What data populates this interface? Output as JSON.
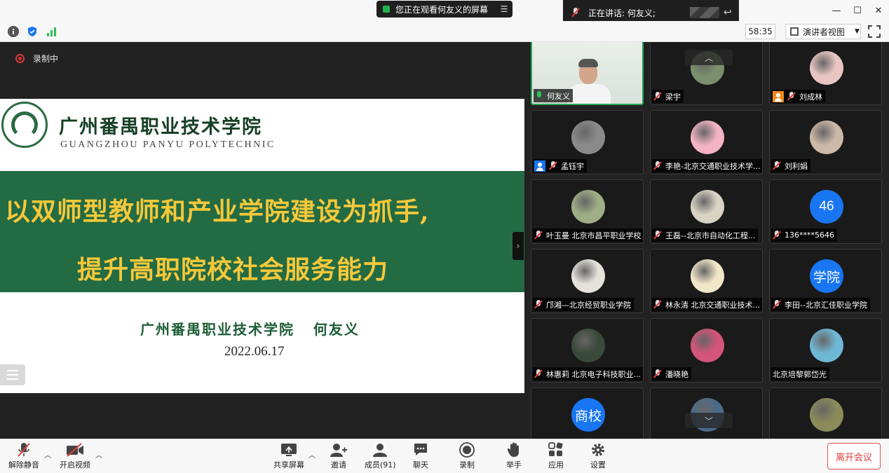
{
  "titlebar": {
    "viewing_text": "您正在观看何友义的屏幕",
    "speaking_text": "正在讲话: 何友义;",
    "window_controls": [
      "minimize-icon",
      "maximize-icon",
      "close-icon"
    ]
  },
  "toolbar": {
    "timer": "58:35",
    "view_mode": "演讲者视图",
    "icons": [
      "info-icon",
      "shield-icon",
      "signal-icon",
      "fullscreen-icon"
    ]
  },
  "share": {
    "recording_label": "录制中",
    "slide": {
      "school_cn": "广州番禺职业技术学院",
      "school_en": "GUANGZHOU PANYU POLYTECHNIC",
      "headline_line1": "以双师型教师和产业学院建设为抓手,",
      "headline_line2": "提升高职院校社会服务能力",
      "author_line": "广州番禺职业技术学院   何友义",
      "date": "2022.06.17"
    }
  },
  "gallery": {
    "participants": [
      {
        "name": "何友义",
        "mic": "on",
        "kind": "video"
      },
      {
        "name": "梁宇",
        "mic": "off",
        "kind": "photo",
        "color": "#7a8f6b"
      },
      {
        "name": "刘成林",
        "mic": "off",
        "kind": "photo",
        "color": "#e9c6c2",
        "badge": "orange"
      },
      {
        "name": "孟钰宇",
        "mic": "off",
        "kind": "photo",
        "color": "#8a8a8a",
        "badge": "blue"
      },
      {
        "name": "李艳-北京交通职业技术学...",
        "mic": "off",
        "kind": "photo",
        "color": "#f3b3c4"
      },
      {
        "name": "刘利娟",
        "mic": "off",
        "kind": "photo",
        "color": "#cdb9a8"
      },
      {
        "name": "叶玉曼 北京市昌平职业学校",
        "mic": "off",
        "kind": "photo",
        "color": "#9fae86"
      },
      {
        "name": "王磊--北京市自动化工程...",
        "mic": "off",
        "kind": "photo",
        "color": "#d9d3c4"
      },
      {
        "name": "136****5646",
        "mic": "off",
        "kind": "text",
        "avatar_text": "46"
      },
      {
        "name": "邝湘—北京经贸职业学院",
        "mic": "off",
        "kind": "photo",
        "color": "#e5e2dc"
      },
      {
        "name": "林永清 北京交通职业技术...",
        "mic": "off",
        "kind": "photo",
        "color": "#f2e6c8"
      },
      {
        "name": "李田--北京汇佳职业学院",
        "mic": "off",
        "kind": "text",
        "avatar_text": "学院"
      },
      {
        "name": "林惠莉  北京电子科技职业...",
        "mic": "off",
        "kind": "photo",
        "color": "#3a4a3a"
      },
      {
        "name": "潘晓艳",
        "mic": "off",
        "kind": "photo",
        "color": "#d4547a"
      },
      {
        "name": "北京培黎郭岱光",
        "mic": "none",
        "kind": "photo",
        "color": "#6fb7d6"
      },
      {
        "name": "",
        "mic": "none",
        "kind": "text",
        "avatar_text": "商校"
      },
      {
        "name": "",
        "mic": "none",
        "kind": "photo",
        "color": "#4b6b8a"
      },
      {
        "name": "",
        "mic": "none",
        "kind": "photo",
        "color": "#8a8a5a"
      }
    ]
  },
  "bottombar": {
    "unmute": "解除静音",
    "start_video": "开启视频",
    "share_screen": "共享屏幕",
    "invite": "邀请",
    "members": "成员(91)",
    "chat": "聊天",
    "record": "录制",
    "raise_hand": "举手",
    "apps": "应用",
    "settings": "设置",
    "leave": "离开会议"
  },
  "colors": {
    "slide_band": "#236b43",
    "headline": "#f6c83a",
    "avatar_blue": "#1876f2",
    "leave_red": "#e23b3b",
    "active_border": "#29a35a"
  }
}
